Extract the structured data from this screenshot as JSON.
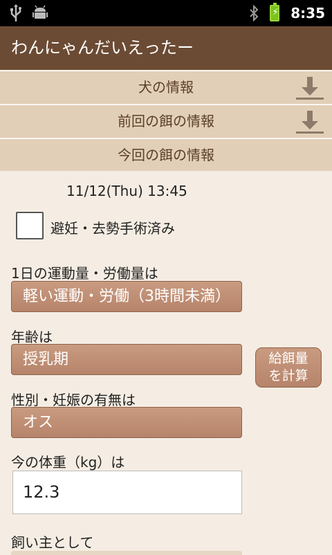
{
  "status_bar": {
    "time": "8:35",
    "icons": [
      "usb-icon",
      "android-debug-icon",
      "bluetooth-icon",
      "battery-charging-icon"
    ]
  },
  "app": {
    "title": "わんにゃんだいえったー"
  },
  "sections": {
    "dog_info": "犬の情報",
    "previous_feed_info": "前回の餌の情報",
    "current_feed_info": "今回の餌の情報"
  },
  "form": {
    "datetime": "11/12(Thu) 13:45",
    "neutered_label": "避妊・去勢手術済み",
    "neutered_checked": false,
    "activity_label": "1日の運動量・労働量は",
    "activity_value": "軽い運動・労働（3時間未満）",
    "age_label": "年齢は",
    "age_value": "授乳期",
    "calc_button": [
      "給餌量",
      "を計算"
    ],
    "sex_label": "性別・妊娠の有無は",
    "sex_value": "オス",
    "weight_label": "今の体重（kg）は",
    "weight_value": "12.3",
    "owner_label": "飼い主として"
  },
  "colors": {
    "title_bar": "#6c4b34",
    "section": "#e2cfb7",
    "background": "#f5ede3",
    "spinner": "#bf8f75"
  }
}
